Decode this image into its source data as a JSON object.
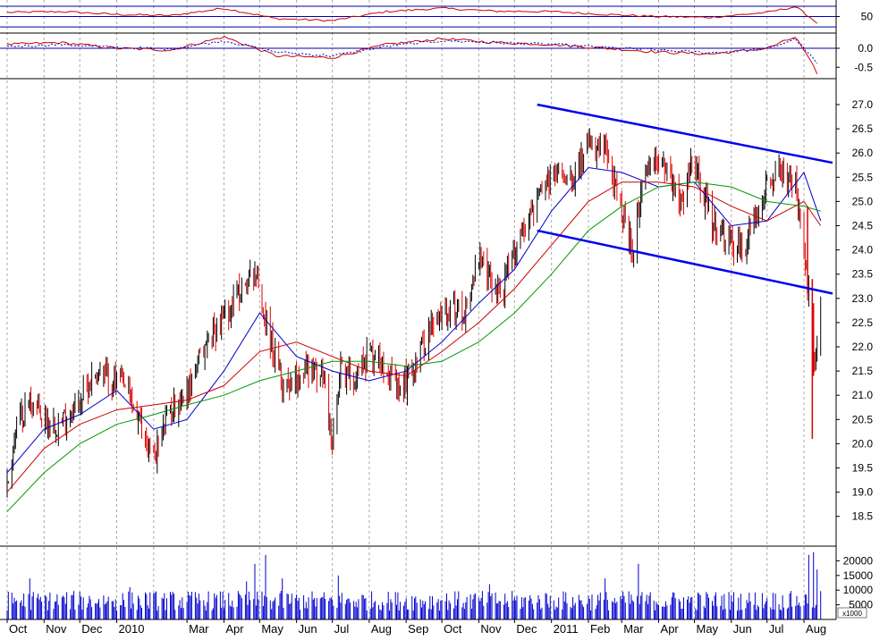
{
  "chart_data": [
    {
      "type": "line",
      "panel": "oscillator-top",
      "y_ticks": [
        "50"
      ],
      "reference_levels": [
        50,
        75,
        25
      ],
      "series": [
        {
          "color": "#cc0000",
          "x": [
            "2009-10-01",
            "2009-11-15",
            "2010-01-01",
            "2010-02-15",
            "2010-04-01",
            "2010-05-15",
            "2010-07-01",
            "2010-08-15",
            "2010-10-01",
            "2010-11-15",
            "2011-01-01",
            "2011-02-15",
            "2011-04-01",
            "2011-05-15",
            "2011-07-01",
            "2011-07-25",
            "2011-08-12"
          ],
          "values": [
            60,
            62,
            55,
            52,
            70,
            45,
            40,
            62,
            70,
            63,
            62,
            55,
            50,
            48,
            60,
            74,
            35
          ]
        }
      ]
    },
    {
      "type": "line",
      "panel": "oscillator-middle",
      "y_ticks": [
        "0.0",
        "-0.5"
      ],
      "reference_levels": [
        0
      ],
      "series": [
        {
          "color": "#cc0000",
          "x": [
            "2009-10-01",
            "2009-11-15",
            "2010-01-01",
            "2010-02-15",
            "2010-04-01",
            "2010-05-15",
            "2010-07-01",
            "2010-08-15",
            "2010-10-01",
            "2010-11-15",
            "2011-01-01",
            "2011-02-15",
            "2011-04-01",
            "2011-05-15",
            "2011-07-01",
            "2011-07-25",
            "2011-08-12"
          ],
          "values": [
            0.1,
            0.15,
            0.0,
            -0.05,
            0.3,
            -0.2,
            -0.25,
            0.1,
            0.25,
            0.15,
            0.1,
            0.0,
            -0.1,
            -0.15,
            0.0,
            0.3,
            -0.65
          ]
        },
        {
          "color": "#0000cc",
          "x": [
            "2009-10-01",
            "2009-11-15",
            "2010-01-01",
            "2010-02-15",
            "2010-04-01",
            "2010-05-15",
            "2010-07-01",
            "2010-08-15",
            "2010-10-01",
            "2010-11-15",
            "2011-01-01",
            "2011-02-15",
            "2011-04-01",
            "2011-05-15",
            "2011-07-01",
            "2011-07-25",
            "2011-08-12"
          ],
          "values": [
            0.05,
            0.1,
            0.02,
            -0.02,
            0.2,
            -0.1,
            -0.2,
            0.05,
            0.2,
            0.15,
            0.1,
            0.02,
            -0.05,
            -0.12,
            -0.02,
            0.25,
            -0.4
          ]
        }
      ]
    },
    {
      "type": "candlestick",
      "panel": "price",
      "y_ticks": [
        "18.5",
        "19.0",
        "19.5",
        "20.0",
        "20.5",
        "21.0",
        "21.5",
        "22.0",
        "22.5",
        "23.0",
        "23.5",
        "24.0",
        "24.5",
        "25.0",
        "25.5",
        "26.0",
        "26.5",
        "27.0"
      ],
      "ylim": [
        18,
        27.5
      ],
      "price_path": {
        "x": [
          "2009-10-01",
          "2009-10-08",
          "2009-10-20",
          "2009-11-01",
          "2009-11-15",
          "2009-12-01",
          "2009-12-15",
          "2010-01-08",
          "2010-01-22",
          "2010-02-01",
          "2010-02-15",
          "2010-03-01",
          "2010-03-20",
          "2010-04-10",
          "2010-04-27",
          "2010-05-07",
          "2010-05-20",
          "2010-06-10",
          "2010-06-25",
          "2010-07-01",
          "2010-07-08",
          "2010-07-20",
          "2010-08-01",
          "2010-08-15",
          "2010-08-25",
          "2010-09-05",
          "2010-09-20",
          "2010-10-05",
          "2010-10-20",
          "2010-11-01",
          "2010-11-10",
          "2010-11-20",
          "2010-12-05",
          "2010-12-20",
          "2011-01-05",
          "2011-01-20",
          "2011-02-01",
          "2011-02-15",
          "2011-03-01",
          "2011-03-10",
          "2011-03-20",
          "2011-04-05",
          "2011-04-20",
          "2011-05-01",
          "2011-05-15",
          "2011-05-25",
          "2011-06-10",
          "2011-06-20",
          "2011-07-01",
          "2011-07-15",
          "2011-07-25",
          "2011-08-05",
          "2011-08-10",
          "2011-08-15"
        ],
        "values": [
          19.1,
          20.3,
          20.9,
          20.5,
          20.4,
          20.9,
          21.5,
          21.2,
          20.3,
          19.7,
          20.7,
          21.1,
          22.2,
          23.0,
          23.6,
          22.4,
          21.2,
          21.6,
          21.3,
          19.9,
          21.5,
          21.4,
          21.9,
          21.7,
          21.0,
          21.5,
          22.3,
          22.8,
          22.7,
          23.8,
          23.4,
          23.1,
          24.3,
          25.0,
          25.6,
          25.6,
          26.1,
          26.0,
          24.8,
          24.0,
          25.5,
          25.9,
          25.0,
          25.9,
          24.6,
          24.2,
          24.0,
          24.6,
          25.5,
          25.6,
          25.3,
          23.1,
          21.5,
          23.0
        ]
      },
      "overlays": [
        {
          "color": "#0000cc",
          "x": [
            "2009-10-01",
            "2009-11-01",
            "2009-12-01",
            "2010-01-01",
            "2010-02-01",
            "2010-03-01",
            "2010-04-01",
            "2010-05-01",
            "2010-06-01",
            "2010-07-01",
            "2010-08-01",
            "2010-09-01",
            "2010-10-01",
            "2010-11-01",
            "2010-12-01",
            "2011-01-01",
            "2011-02-01",
            "2011-03-01",
            "2011-04-01",
            "2011-05-01",
            "2011-06-01",
            "2011-07-01",
            "2011-08-01",
            "2011-08-15"
          ],
          "values": [
            19.4,
            20.3,
            20.6,
            21.1,
            20.3,
            20.5,
            21.5,
            22.7,
            21.8,
            21.5,
            21.3,
            21.5,
            22.1,
            22.9,
            23.6,
            24.8,
            25.7,
            25.6,
            25.3,
            25.4,
            24.5,
            24.6,
            25.6,
            24.6
          ]
        },
        {
          "color": "#cc0000",
          "x": [
            "2009-10-01",
            "2009-11-01",
            "2009-12-01",
            "2010-01-01",
            "2010-02-01",
            "2010-03-01",
            "2010-04-01",
            "2010-05-01",
            "2010-06-01",
            "2010-07-01",
            "2010-08-01",
            "2010-09-01",
            "2010-10-01",
            "2010-11-01",
            "2010-12-01",
            "2011-01-01",
            "2011-02-01",
            "2011-03-01",
            "2011-04-01",
            "2011-05-01",
            "2011-06-01",
            "2011-07-01",
            "2011-08-01",
            "2011-08-15"
          ],
          "values": [
            19.0,
            19.9,
            20.4,
            20.7,
            20.8,
            20.9,
            21.2,
            21.9,
            22.1,
            21.8,
            21.5,
            21.4,
            21.9,
            22.5,
            23.2,
            24.1,
            25.0,
            25.4,
            25.4,
            25.3,
            24.9,
            24.6,
            25.0,
            24.5
          ]
        },
        {
          "color": "#009900",
          "x": [
            "2009-10-01",
            "2009-11-01",
            "2009-12-01",
            "2010-01-01",
            "2010-02-01",
            "2010-03-01",
            "2010-04-01",
            "2010-05-01",
            "2010-06-01",
            "2010-07-01",
            "2010-08-01",
            "2010-09-01",
            "2010-10-01",
            "2010-11-01",
            "2010-12-01",
            "2011-01-01",
            "2011-02-01",
            "2011-03-01",
            "2011-04-01",
            "2011-05-01",
            "2011-06-01",
            "2011-07-01",
            "2011-08-01",
            "2011-08-15"
          ],
          "values": [
            18.6,
            19.4,
            20.0,
            20.4,
            20.6,
            20.8,
            21.0,
            21.3,
            21.5,
            21.7,
            21.7,
            21.6,
            21.7,
            22.1,
            22.7,
            23.5,
            24.4,
            24.9,
            25.3,
            25.4,
            25.3,
            25.0,
            24.9,
            24.8
          ]
        }
      ],
      "annotations": [
        {
          "type": "trendline",
          "color": "#0000ee",
          "x": [
            "2010-12-20",
            "2011-08-25"
          ],
          "values": [
            27.0,
            25.8
          ]
        },
        {
          "type": "trendline",
          "color": "#0000ee",
          "x": [
            "2010-12-20",
            "2011-08-25"
          ],
          "values": [
            24.4,
            23.1
          ]
        }
      ]
    },
    {
      "type": "bar",
      "panel": "volume",
      "y_ticks": [
        "20000",
        "15000",
        "10000",
        "5000"
      ],
      "units_label": "x1000",
      "bar_color": "#0000cc",
      "base_volume": 7500,
      "spikes": [
        {
          "x": "2009-10-20",
          "value": 14000
        },
        {
          "x": "2010-01-12",
          "value": 11000
        },
        {
          "x": "2010-04-20",
          "value": 13000
        },
        {
          "x": "2010-04-27",
          "value": 19000
        },
        {
          "x": "2010-05-06",
          "value": 22000
        },
        {
          "x": "2010-05-20",
          "value": 14000
        },
        {
          "x": "2010-07-06",
          "value": 15000
        },
        {
          "x": "2010-11-10",
          "value": 12000
        },
        {
          "x": "2011-02-15",
          "value": 14000
        },
        {
          "x": "2011-03-15",
          "value": 19000
        },
        {
          "x": "2011-08-05",
          "value": 22000
        },
        {
          "x": "2011-08-09",
          "value": 23000
        },
        {
          "x": "2011-08-12",
          "value": 17000
        }
      ]
    }
  ],
  "x_axis": {
    "month_labels": [
      {
        "label": "Oct",
        "date": "2009-10-01"
      },
      {
        "label": "Nov",
        "date": "2009-11-01"
      },
      {
        "label": "Dec",
        "date": "2009-12-01"
      },
      {
        "label": "2010",
        "date": "2010-01-01"
      },
      {
        "label": "Mar",
        "date": "2010-03-01"
      },
      {
        "label": "Apr",
        "date": "2010-04-01"
      },
      {
        "label": "May",
        "date": "2010-05-01"
      },
      {
        "label": "Jun",
        "date": "2010-06-01"
      },
      {
        "label": "Jul",
        "date": "2010-07-01"
      },
      {
        "label": "Aug",
        "date": "2010-08-01"
      },
      {
        "label": "Sep",
        "date": "2010-09-01"
      },
      {
        "label": "Oct",
        "date": "2010-10-01"
      },
      {
        "label": "Nov",
        "date": "2010-11-01"
      },
      {
        "label": "Dec",
        "date": "2010-12-01"
      },
      {
        "label": "2011",
        "date": "2011-01-01"
      },
      {
        "label": "Feb",
        "date": "2011-02-01"
      },
      {
        "label": "Mar",
        "date": "2011-03-01"
      },
      {
        "label": "Apr",
        "date": "2011-04-01"
      },
      {
        "label": "May",
        "date": "2011-05-01"
      },
      {
        "label": "Jun",
        "date": "2011-06-01"
      },
      {
        "label": "Jul",
        "date": "2011-07-01"
      },
      {
        "label": "Aug",
        "date": "2011-08-01"
      }
    ],
    "extra_grid_dates": [
      "2010-02-01"
    ],
    "range": [
      "2009-09-25",
      "2011-08-28"
    ]
  },
  "colors": {
    "grid": "#aaaaaa",
    "frame": "#000000",
    "up_candle": "#000000",
    "down_candle": "#dd0000",
    "reference_line": "#0000aa"
  }
}
